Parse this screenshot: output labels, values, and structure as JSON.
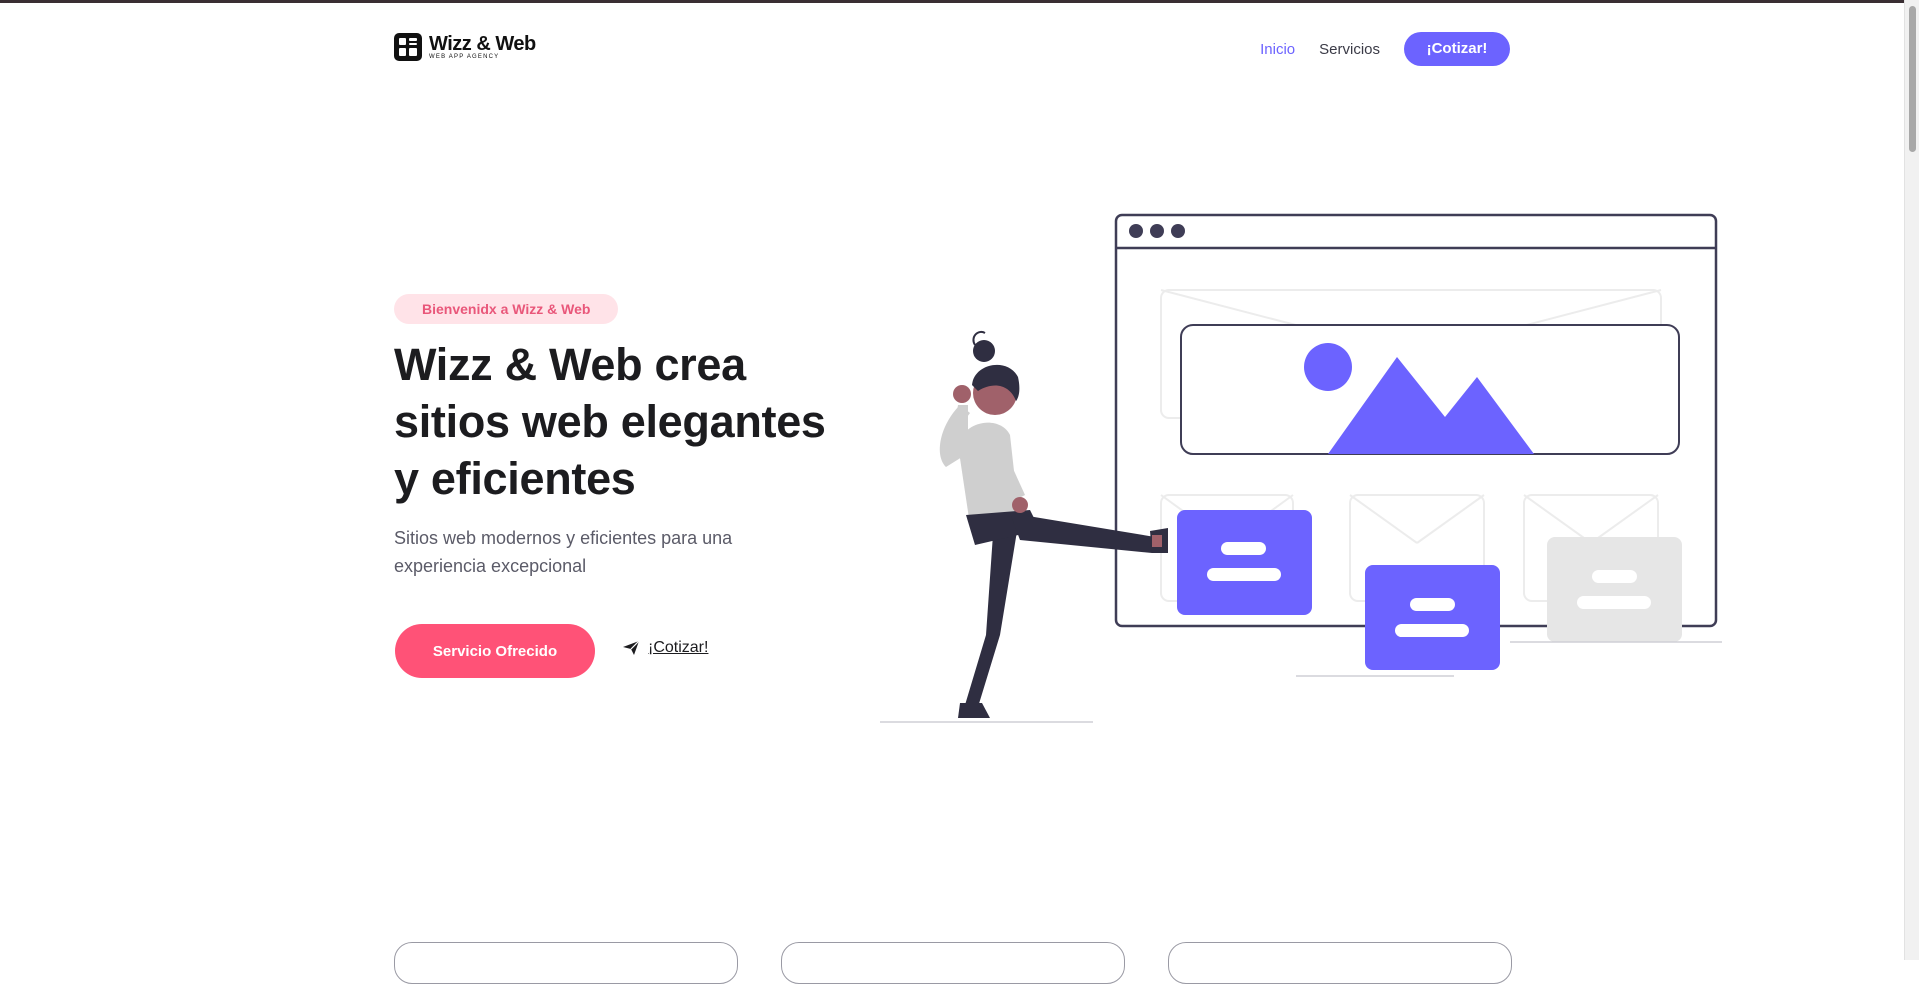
{
  "brand": {
    "name": "Wizz & Web",
    "tagline": "WEB APP AGENCY"
  },
  "nav": {
    "items": [
      {
        "label": "Inicio",
        "active": true
      },
      {
        "label": "Servicios",
        "active": false
      }
    ],
    "cta_label": "¡Cotizar!"
  },
  "hero": {
    "badge": "Bienvenidx a Wizz & Web",
    "headline": "Wizz & Web crea sitios web elegantes y eficientes",
    "subtitle": "Sitios web modernos y eficientes para una experiencia excepcional",
    "primary_button": "Servicio Ofrecido",
    "secondary_link": "¡Cotizar!"
  },
  "colors": {
    "accent": "#6c63ff",
    "primary_button": "#ff5277",
    "badge_bg": "#ffe3e8",
    "badge_text": "#e9577a"
  },
  "icons": {
    "send": "paper-plane-icon",
    "logo": "logo-grid-icon"
  }
}
